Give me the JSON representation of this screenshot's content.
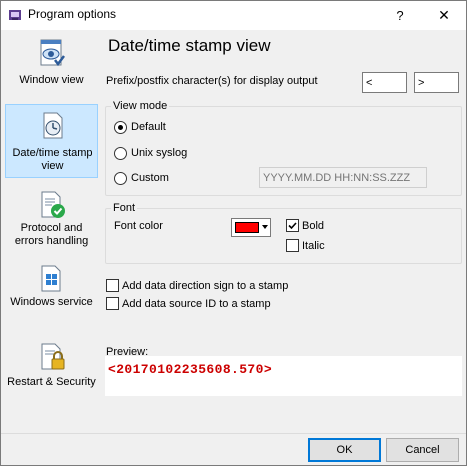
{
  "window": {
    "title": "Program options"
  },
  "titlebar": {
    "help_label": "?",
    "close_label": "✕"
  },
  "sidebar": {
    "items": [
      {
        "label": "Window view",
        "icon": "eye-window-icon"
      },
      {
        "label": "Date/time stamp view",
        "icon": "clock-document-icon",
        "selected": true
      },
      {
        "label": "Protocol and errors handling",
        "icon": "check-document-icon"
      },
      {
        "label": "Windows service",
        "icon": "service-document-icon"
      },
      {
        "label": "Restart & Security",
        "icon": "lock-document-icon"
      }
    ]
  },
  "main": {
    "title": "Date/time stamp view",
    "prefix_label": "Prefix/postfix character(s) for display output",
    "prefix_value": "<",
    "postfix_value": ">",
    "view_mode": {
      "title": "View mode",
      "options": [
        "Default",
        "Unix syslog",
        "Custom"
      ],
      "selected": "Default",
      "custom_placeholder": "YYYY.MM.DD HH:NN:SS.ZZZ"
    },
    "font": {
      "title": "Font",
      "color_label": "Font color",
      "color": "#ff0000",
      "bold_label": "Bold",
      "bold_checked": true,
      "italic_label": "Italic",
      "italic_checked": false
    },
    "add_direction_label": "Add data direction sign to a stamp",
    "add_source_label": "Add data source ID to a stamp",
    "preview_label": "Preview:",
    "preview_value": "<20170102235608.570>",
    "preview_color": "#cc0000"
  },
  "footer": {
    "ok_label": "OK",
    "cancel_label": "Cancel"
  }
}
